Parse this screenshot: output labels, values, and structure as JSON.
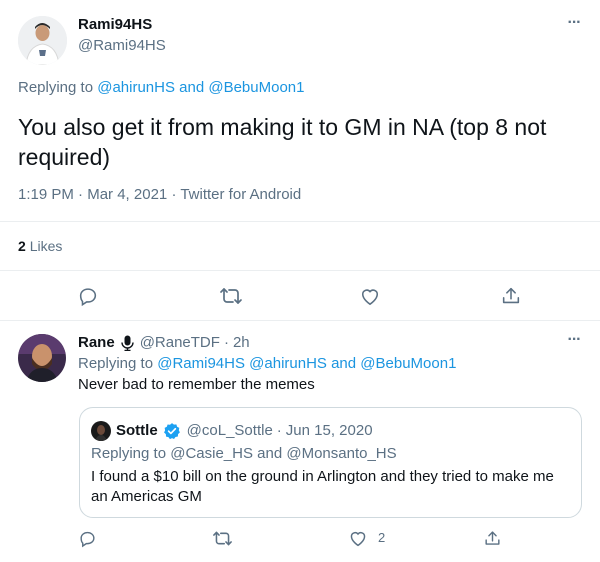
{
  "main_tweet": {
    "author_name": "Rami94HS",
    "author_handle": "@Rami94HS",
    "replying_prefix": "Replying to",
    "replying_user1": "@ahirunHS",
    "replying_and": "and",
    "replying_user2": "@BebuMoon1",
    "text_line1": "You also get it from making it to GM in NA (top 8 not",
    "text_line2": "required)",
    "time": "1:19 PM",
    "sep1": "·",
    "date": "Mar 4, 2021",
    "sep2": "·",
    "source": "Twitter for Android",
    "likes_count": "2",
    "likes_label": "Likes",
    "more": "···"
  },
  "reply": {
    "author_name": "Rane",
    "author_handle": "@RaneTDF",
    "sep": "·",
    "time": "2h",
    "replying_prefix": "Replying to",
    "replying_user1": "@Rami94HS",
    "replying_user2": "@ahirunHS",
    "replying_and": "and",
    "replying_user3": "@BebuMoon1",
    "text": "Never bad to remember the memes",
    "more": "···",
    "like_count": "2",
    "quoted": {
      "author_name": "Sottle",
      "author_handle": "@coL_Sottle",
      "sep": "·",
      "date": "Jun 15, 2020",
      "replying_prefix": "Replying to",
      "replying_user1": "@Casie_HS",
      "replying_and": "and",
      "replying_user2": "@Monsanto_HS",
      "text_line1": "I found a $10 bill on the ground in Arlington and they tried to make me",
      "text_line2": "an Americas GM"
    }
  },
  "icons": {
    "reply": "reply-icon",
    "retweet": "retweet-icon",
    "like": "heart-icon",
    "share": "share-icon",
    "verified": "verified-badge-icon",
    "mic": "microphone-icon"
  },
  "colors": {
    "link": "#1b95e0",
    "muted": "#5b7083",
    "text": "#0f1419",
    "icon": "#5b7083",
    "verified": "#1da1f2"
  }
}
